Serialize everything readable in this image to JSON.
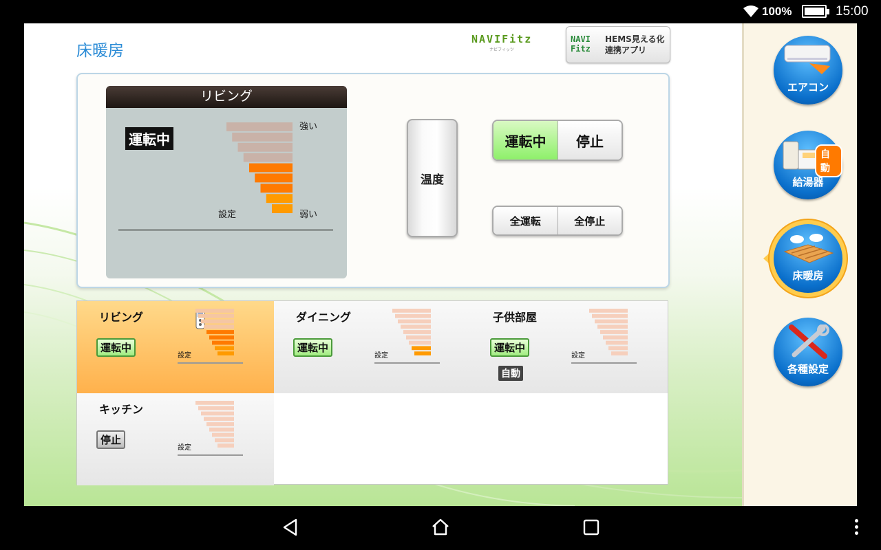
{
  "status_bar": {
    "battery": "100%",
    "time": "15:00",
    "icons": [
      "wifi-icon",
      "battery-icon"
    ]
  },
  "header": {
    "title": "床暖房",
    "brand_logo": "NAVIFitz",
    "brand_logo_sub": "ナビフィッツ",
    "hems_logo_line1": "NAVI",
    "hems_logo_line2": "Fitz",
    "hems_button_line1": "HEMS見える化",
    "hems_button_line2": "連携アプリ"
  },
  "display": {
    "room_title": "リビング",
    "status": "運転中",
    "strong_label": "強い",
    "weak_label": "弱い",
    "set_label": "設定",
    "level_active": 5,
    "level_total": 9
  },
  "controls": {
    "temp_button": "温度",
    "run_label": "運転中",
    "stop_label": "停止",
    "all_run": "全運転",
    "all_stop": "全停止"
  },
  "rooms": [
    {
      "name": "リビング",
      "status": "運転中",
      "running": true,
      "auto": "",
      "set_label": "設定",
      "level_active": 5,
      "selected": true
    },
    {
      "name": "ダイニング",
      "status": "運転中",
      "running": true,
      "auto": "",
      "set_label": "設定",
      "level_active": 2,
      "selected": false
    },
    {
      "name": "子供部屋",
      "status": "運転中",
      "running": true,
      "auto": "自動",
      "set_label": "設定",
      "level_active": 0,
      "selected": false
    },
    {
      "name": "キッチン",
      "status": "停止",
      "running": false,
      "auto": "",
      "set_label": "設定",
      "level_active": 0,
      "selected": false
    }
  ],
  "sidebar": {
    "items": [
      {
        "label": "エアコン",
        "icon": "air-conditioner-icon"
      },
      {
        "label": "給湯器",
        "icon": "water-heater-icon",
        "badge": "自動"
      },
      {
        "label": "床暖房",
        "icon": "floor-heating-icon",
        "active": true
      },
      {
        "label": "各種設定",
        "icon": "tools-icon"
      }
    ]
  },
  "colors": {
    "accent_blue": "#0a6fcb",
    "active_orange": "#ff8a00",
    "inactive_bar": "#c8b2a6",
    "run_green": "#8ef06a"
  }
}
